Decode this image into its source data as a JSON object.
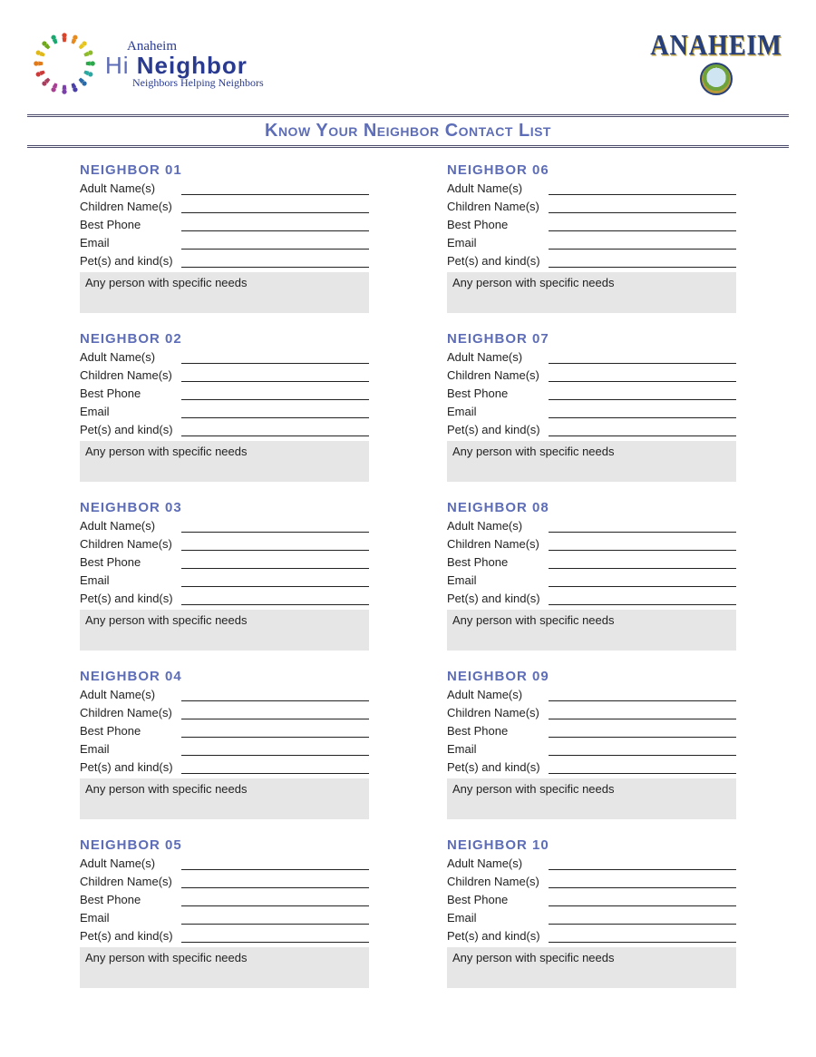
{
  "header": {
    "left_logo": {
      "top_script": "Anaheim",
      "hi": "Hi ",
      "neighbor": "Neighbor",
      "tagline": "Neighbors Helping Neighbors"
    },
    "right_logo": {
      "text": "ANAHEIM"
    }
  },
  "title": "Know Your Neighbor Contact List",
  "field_labels": {
    "adult": "Adult Name(s)",
    "children": "Children Name(s)",
    "phone": "Best Phone",
    "email": "Email",
    "pets": "Pet(s) and kind(s)",
    "needs": "Any person with specific needs"
  },
  "blocks": [
    {
      "heading": "NEIGHBOR  01"
    },
    {
      "heading": "NEIGHBOR  06"
    },
    {
      "heading": "NEIGHBOR  02"
    },
    {
      "heading": "NEIGHBOR  07"
    },
    {
      "heading": "NEIGHBOR  03"
    },
    {
      "heading": "NEIGHBOR  08"
    },
    {
      "heading": "NEIGHBOR  04"
    },
    {
      "heading": "NEIGHBOR  09"
    },
    {
      "heading": "NEIGHBOR  05"
    },
    {
      "heading": "NEIGHBOR  10"
    }
  ]
}
